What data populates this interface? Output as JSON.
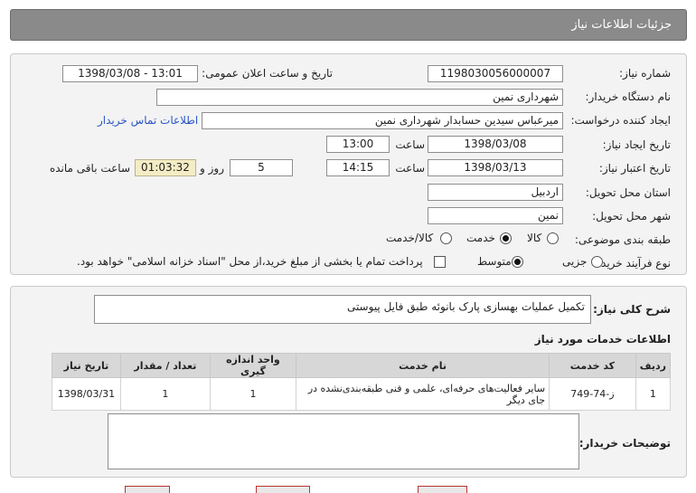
{
  "header": {
    "title": "جزئیات اطلاعات نیاز"
  },
  "form": {
    "need_number": {
      "label": "شماره نیاز:",
      "value": "1198030056000007"
    },
    "announce": {
      "label": "تاریخ و ساعت اعلان عمومی:",
      "value": "1398/03/08 - 13:01"
    },
    "buyer_org": {
      "label": "نام دستگاه خریدار:",
      "value": "شهرداری نمین"
    },
    "requester": {
      "label": "ایجاد کننده درخواست:",
      "value": "میرعباس سیدین حسابدار شهرداری نمین"
    },
    "contact_link": "اطلاعات تماس خریدار",
    "created": {
      "label": "تاریخ ایجاد نیاز:",
      "date": "1398/03/08",
      "time_label": "ساعت",
      "time": "13:00"
    },
    "validity": {
      "label": "تاریخ اعتبار نیاز:",
      "date": "1398/03/13",
      "time_label": "ساعت",
      "time": "14:15",
      "days_label": "روز و",
      "days": "5",
      "remaining": "01:03:32",
      "remaining_label": "ساعت باقی مانده"
    },
    "province": {
      "label": "استان محل تحویل:",
      "value": "اردبیل"
    },
    "city": {
      "label": "شهر محل تحویل:",
      "value": "نمین"
    },
    "category": {
      "label": "طبقه بندی موضوعی:",
      "options": [
        "کالا",
        "خدمت",
        "کالا/خدمت"
      ],
      "selected": "خدمت"
    },
    "process": {
      "label": "نوع فرآیند خرید :",
      "options": [
        "جزیی",
        "متوسط"
      ],
      "selected": "متوسط",
      "note": "پرداخت تمام یا بخشی از مبلغ خرید،از محل \"اسناد خزانه اسلامی\" خواهد بود."
    }
  },
  "summary": {
    "label": "شرح کلی نیاز:",
    "value": "تکمیل عملیات بهسازی پارک بانوئه طبق فایل پیوستی"
  },
  "services": {
    "title": "اطلاعات خدمات مورد نیاز",
    "columns": [
      "ردیف",
      "کد خدمت",
      "نام خدمت",
      "واحد اندازه گیری",
      "تعداد / مقدار",
      "تاریخ نیاز"
    ],
    "rows": [
      {
        "row": "1",
        "code": "ز-74-749",
        "name": "سایر فعالیت‌های حرفه‌ای، علمی و فنی طبقه‌بندی‌نشده در جای دیگر",
        "unit": "1",
        "qty": "1",
        "date": "1398/03/31"
      }
    ]
  },
  "buyer_notes": {
    "label": "توضیحات خریدار:",
    "value": ""
  },
  "colors": {
    "header_bg": "#8a8a8a",
    "panel_bg": "#f3f3f3",
    "timer_bg": "#f4ecc4",
    "link": "#2a56c6"
  }
}
